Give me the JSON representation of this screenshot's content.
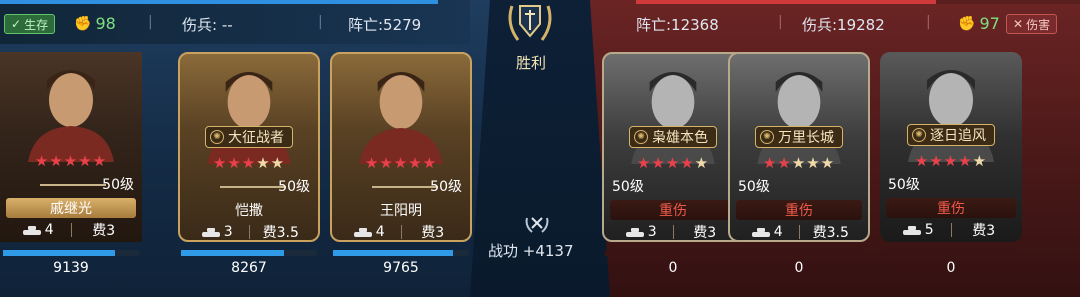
{
  "left_header": {
    "survive_label": "生存",
    "morale": "98",
    "wounded": "伤兵: --",
    "dead": "阵亡:5279"
  },
  "right_header": {
    "dead": "阵亡:12368",
    "wounded": "伤兵:19282",
    "morale": "97",
    "harm_label": "伤害"
  },
  "result": {
    "victory": "胜利",
    "merit": "战功 +4137"
  },
  "left_generals": [
    {
      "name": "戚继光",
      "tag": "",
      "stars_on": 5,
      "stars_total": 5,
      "level": "50级",
      "troops": "4",
      "cost": "费3",
      "hp": "9139",
      "hp_fraction": 0.82
    },
    {
      "name": "恺撒",
      "tag": "大征战者",
      "stars_on": 3,
      "stars_total": 5,
      "level": "50级",
      "troops": "3",
      "cost": "费3.5",
      "hp": "8267",
      "hp_fraction": 0.76
    },
    {
      "name": "王阳明",
      "tag": "",
      "stars_on": 5,
      "stars_total": 5,
      "level": "50级",
      "troops": "4",
      "cost": "费3",
      "hp": "9765",
      "hp_fraction": 0.88
    }
  ],
  "right_generals": [
    {
      "name": "重伤",
      "tag": "枭雄本色",
      "stars_on": 4,
      "stars_total": 5,
      "level": "50级",
      "troops": "3",
      "cost": "费3",
      "hp": "0",
      "hp_fraction": 0
    },
    {
      "name": "重伤",
      "tag": "万里长城",
      "stars_on": 2,
      "stars_total": 5,
      "level": "50级",
      "troops": "4",
      "cost": "费3.5",
      "hp": "0",
      "hp_fraction": 0
    },
    {
      "name": "重伤",
      "tag": "逐日追风",
      "stars_on": 4,
      "stars_total": 5,
      "level": "50级",
      "troops": "5",
      "cost": "费3",
      "hp": "0",
      "hp_fraction": 0
    }
  ],
  "colors": {
    "ally": "#2f9be8",
    "enemy": "#c83030",
    "star_on": "#e8414b",
    "gold": "#d5b36a"
  }
}
